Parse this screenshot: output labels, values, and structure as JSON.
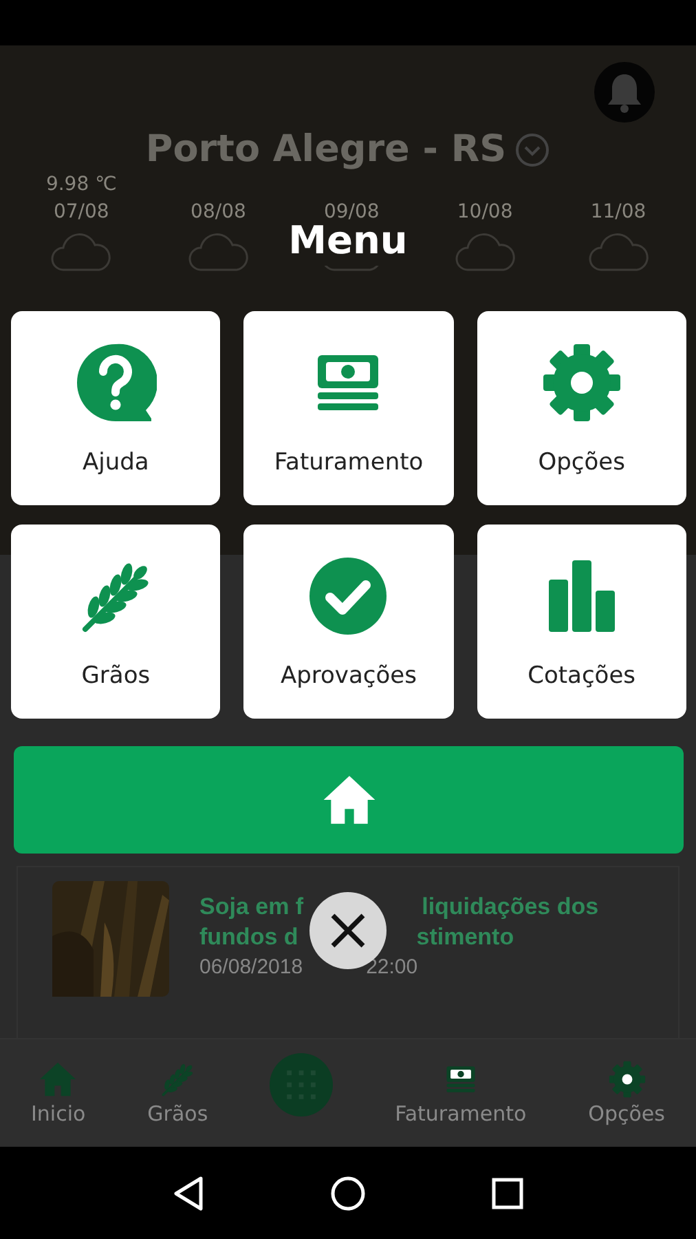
{
  "header": {
    "location": "Porto Alegre - RS"
  },
  "forecast": [
    {
      "temp": "9.98 ℃",
      "date": "07/08"
    },
    {
      "date": "08/08"
    },
    {
      "date": "09/08"
    },
    {
      "date": "10/08"
    },
    {
      "date": "11/08"
    }
  ],
  "news": {
    "title_lines": [
      [
        "Soja em f",
        "liquidações dos"
      ],
      [
        "fundos d",
        "stimento"
      ]
    ],
    "date_parts": [
      "06/08/2018",
      "22:00"
    ]
  },
  "bottom_nav": [
    {
      "kind": "tab",
      "label": "Inicio"
    },
    {
      "kind": "tab",
      "label": "Grãos"
    },
    {
      "kind": "center"
    },
    {
      "kind": "tab",
      "label": "Faturamento"
    },
    {
      "kind": "tab",
      "label": "Opções"
    }
  ],
  "menu": {
    "title": "Menu",
    "items": [
      {
        "label": "Ajuda"
      },
      {
        "label": "Faturamento"
      },
      {
        "label": "Opções"
      },
      {
        "label": "Grãos"
      },
      {
        "label": "Aprovações"
      },
      {
        "label": "Cotações"
      }
    ]
  }
}
